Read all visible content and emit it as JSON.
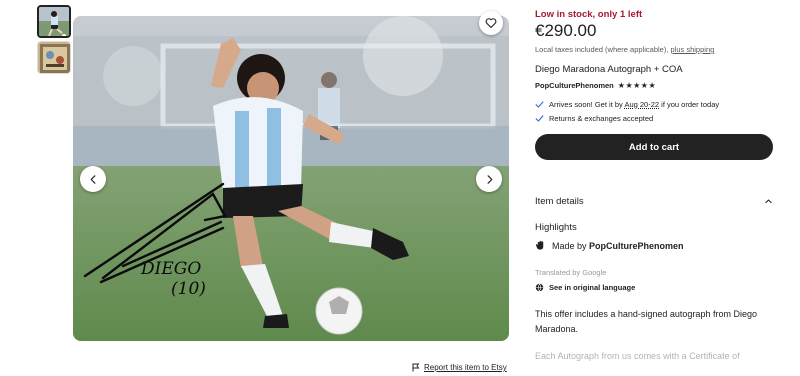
{
  "gallery": {
    "thumbnails": [
      {
        "alt": "thumbnail-1"
      },
      {
        "alt": "thumbnail-2"
      }
    ],
    "signature_lines": [
      "DIEGO",
      "(10)"
    ]
  },
  "report": {
    "label": "Report this item to Etsy"
  },
  "listing": {
    "stock_notice": "Low in stock, only 1 left",
    "price": "€290.00",
    "taxes_text": "Local taxes included (where applicable), ",
    "shipping_link": "plus shipping",
    "title": "Diego Maradona Autograph + COA",
    "shop_name": "PopCulturePhenomen",
    "rating_stars": "★★★★★",
    "rating_value": 5,
    "arrives_pre": "Arrives soon! Get it by ",
    "arrives_date": "Aug 20-22",
    "arrives_post": " if you order today",
    "returns_text": "Returns & exchanges accepted",
    "cart_button": "Add to cart",
    "item_details": "Item details",
    "highlights": "Highlights",
    "made_by_prefix": "Made by ",
    "made_by_shop": "PopCulturePhenomen",
    "translated_by": "Translated by Google",
    "original_language": "See in original language",
    "description_1": "This offer includes a hand-signed autograph from Diego Maradona.",
    "description_2": "Each Autograph from us comes with a Certificate of"
  },
  "colors": {
    "stock_red": "#a61a2e",
    "button_dark": "#222222",
    "check_blue": "#2a6fd6"
  },
  "icons": [
    "heart-icon",
    "chevron-left-icon",
    "chevron-right-icon",
    "flag-icon",
    "check-icon",
    "chevron-up-icon",
    "hand-wave-icon",
    "globe-icon"
  ]
}
